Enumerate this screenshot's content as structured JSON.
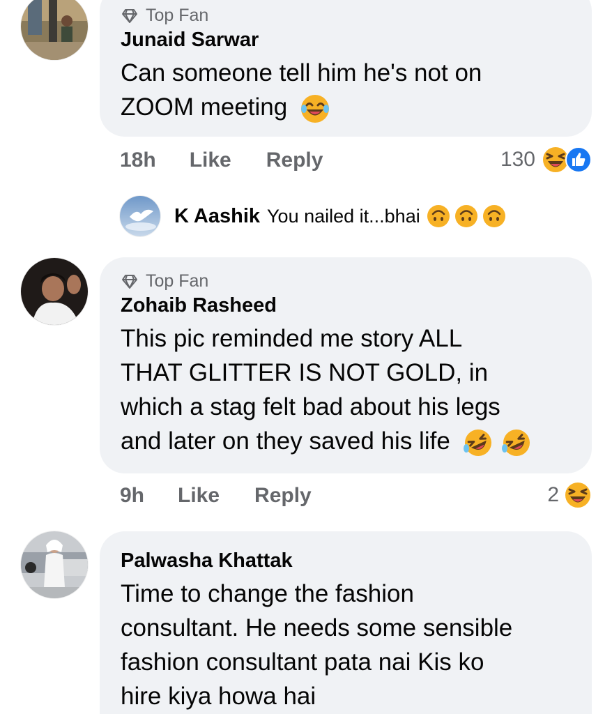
{
  "comments": [
    {
      "badge": "Top Fan",
      "author": "Junaid Sarwar",
      "lines": [
        "Can someone tell him he's not on",
        "ZOOM meeting"
      ],
      "time": "18h",
      "like": "Like",
      "reply": "Reply",
      "reactions_count": "130",
      "reactions": [
        "haha",
        "like"
      ]
    },
    {
      "badge": "Top Fan",
      "author": "Zohaib Rasheed",
      "lines": [
        "This pic reminded me story ALL",
        "THAT GLITTER IS NOT GOLD, in",
        "which a stag felt bad about his legs",
        "and later on they saved his life"
      ],
      "time": "9h",
      "like": "Like",
      "reply": "Reply",
      "reactions_count": "2",
      "reactions": [
        "haha"
      ]
    },
    {
      "author": "Palwasha Khattak",
      "lines": [
        "Time to change the fashion",
        "consultant. He needs some sensible",
        "fashion consultant pata nai Kis ko",
        "hire kiya howa hai"
      ]
    }
  ],
  "reply": {
    "author": "K Aashik",
    "text": "You nailed it...bhai"
  },
  "colors": {
    "bubble": "#f0f2f5",
    "secondary_text": "#65676b",
    "like_blue": "#1877f2",
    "emoji_yellow": "#f7b125"
  }
}
